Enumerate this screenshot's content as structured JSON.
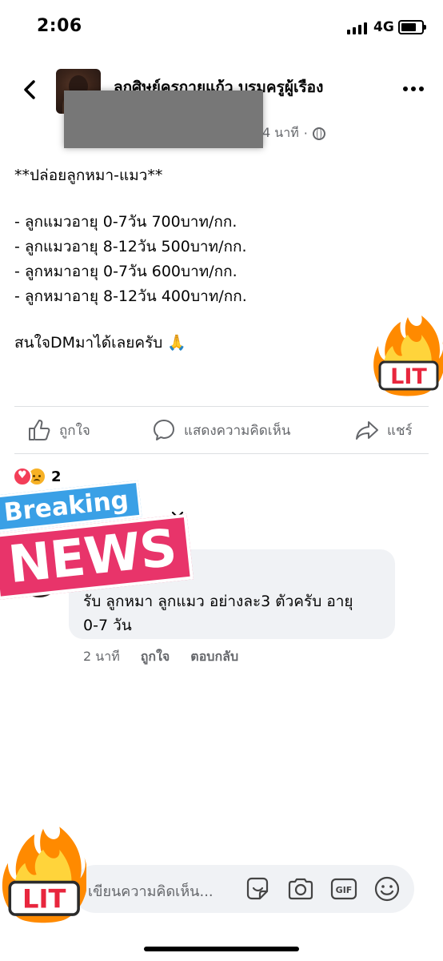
{
  "status_bar": {
    "time": "2:06",
    "network": "4G"
  },
  "post": {
    "author": "ลกศิษย์ครกายแก้ว บรมครูผู้เรือง",
    "time": "4 นาที",
    "separator": "·",
    "body_lines": [
      "**ปล่อยลูกหมา-แมว**",
      "- ลูกแมวอายุ 0-7วัน 700บาท/กก.",
      "- ลูกแมวอายุ 8-12วัน 500บาท/กก.",
      "- ลูกหมาอายุ 0-7วัน 600บาท/กก.",
      "- ลูกหมาอายุ 8-12วัน 400บาท/กก.",
      "สนใจDMมาได้เลยครับ 🙏"
    ]
  },
  "actions": {
    "like": "ถูกใจ",
    "comment": "แสดงความคิดเห็น",
    "share": "แชร์"
  },
  "reactions": {
    "count": "2"
  },
  "stickers": {
    "breaking": "Breaking",
    "news": "NEWS",
    "lit": "LIT"
  },
  "comment": {
    "text_lines": [
      "รับ ลูกหมา ลูกแมว อย่างละ3 ตัวครับ อายุ",
      "0-7 วัน"
    ],
    "time": "2 นาที",
    "like": "ถูกใจ",
    "reply": "ตอบกลับ"
  },
  "composer": {
    "placeholder": "เขียนความคิดเห็น...",
    "gif": "GIF"
  }
}
